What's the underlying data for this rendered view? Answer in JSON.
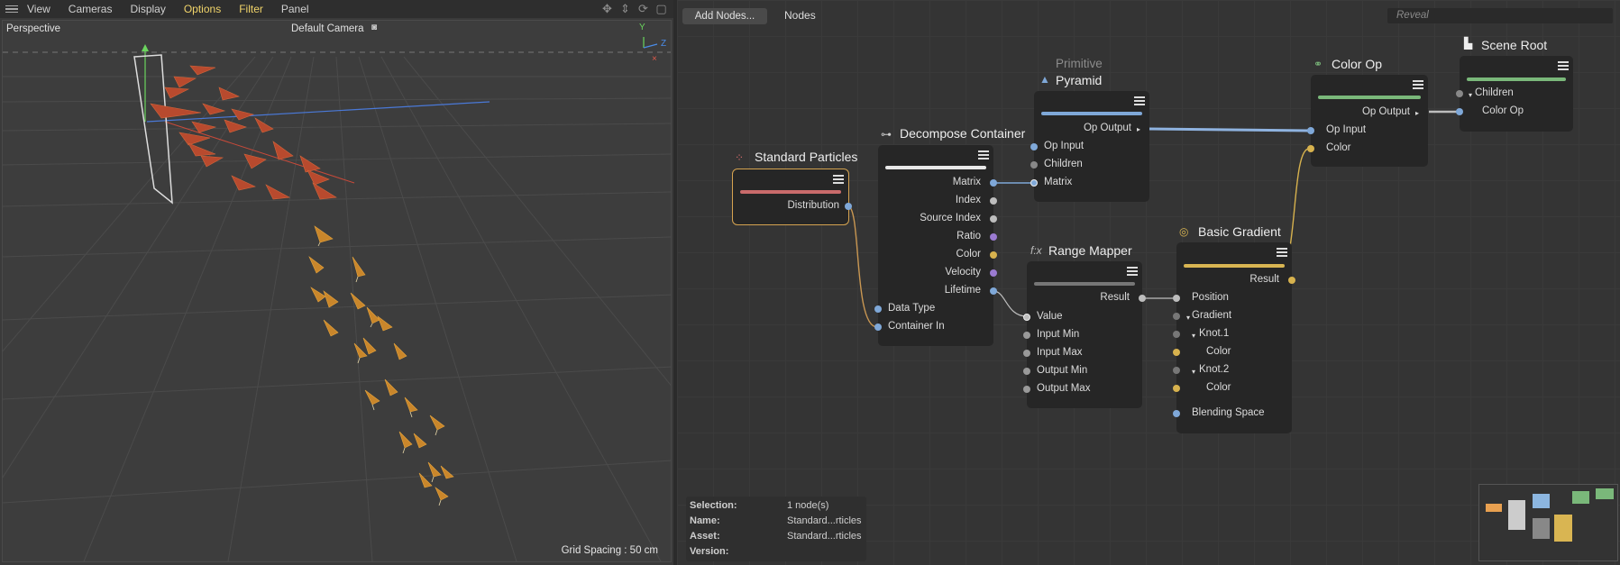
{
  "menubar": {
    "items": [
      "View",
      "Cameras",
      "Display",
      "Options",
      "Filter",
      "Panel"
    ]
  },
  "viewport": {
    "projection": "Perspective",
    "camera": "Default Camera",
    "grid_spacing": "Grid Spacing : 50 cm",
    "axis_y": "Y",
    "axis_z": "Z"
  },
  "toolbar": {
    "add_nodes": "Add Nodes...",
    "nodes_label": "Nodes",
    "reveal_placeholder": "Reveal"
  },
  "nodes": {
    "standard_particles": {
      "title": "Standard Particles",
      "port": "Distribution",
      "bar_color": "#c96b6b"
    },
    "decompose": {
      "title": "Decompose Container",
      "outputs": [
        "Matrix",
        "Index",
        "Source Index",
        "Ratio",
        "Color",
        "Velocity",
        "Lifetime"
      ],
      "inputs": [
        "Data Type",
        "Container In"
      ]
    },
    "pyramid": {
      "category": "Primitive",
      "title": "Pyramid",
      "output": "Op Output",
      "inputs": [
        "Op Input",
        "Children",
        "Matrix"
      ],
      "bar_color": "#7fa8d8"
    },
    "range_mapper": {
      "title": "Range Mapper",
      "output": "Result",
      "inputs": [
        "Value",
        "Input Min",
        "Input Max",
        "Output Min",
        "Output Max"
      ]
    },
    "basic_gradient": {
      "title": "Basic Gradient",
      "output": "Result",
      "inputs": [
        "Position",
        "Gradient",
        "Knot.1",
        "Color",
        "Knot.2",
        "Color",
        "Blending Space"
      ],
      "bar_color": "#d9b552"
    },
    "color_op": {
      "title": "Color Op",
      "output": "Op Output",
      "inputs": [
        "Op Input",
        "Color"
      ],
      "bar_color": "#7ab87a"
    },
    "scene_root": {
      "title": "Scene Root",
      "inputs": [
        "Children",
        "Color Op"
      ],
      "bar_color": "#7ab87a"
    }
  },
  "info": {
    "selection_label": "Selection:",
    "selection_value": "1 node(s)",
    "name_label": "Name:",
    "name_value": "Standard...rticles",
    "asset_label": "Asset:",
    "asset_value": "Standard...rticles",
    "version_label": "Version:"
  }
}
